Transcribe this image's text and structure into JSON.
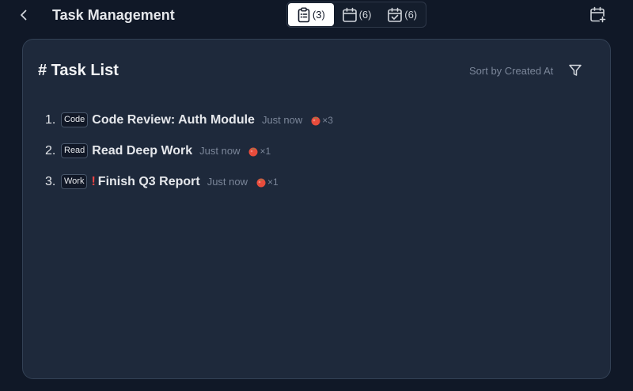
{
  "header": {
    "title": "Task Management",
    "tabs": [
      {
        "icon": "clipboard-list-icon",
        "count": "(3)",
        "active": true
      },
      {
        "icon": "calendar-icon",
        "count": "(6)",
        "active": false
      },
      {
        "icon": "calendar-check-icon",
        "count": "(6)",
        "active": false
      }
    ]
  },
  "panel": {
    "title": "# Task List",
    "sort_label": "Sort by Created At"
  },
  "tasks": [
    {
      "num": "1.",
      "tag": "Code",
      "urgent": "",
      "title": "Code Review: Auth Module",
      "time": "Just now",
      "pomodoros": "×3"
    },
    {
      "num": "2.",
      "tag": "Read",
      "urgent": "",
      "title": "Read Deep Work",
      "time": "Just now",
      "pomodoros": "×1"
    },
    {
      "num": "3.",
      "tag": "Work",
      "urgent": "!",
      "title": "Finish Q3 Report",
      "time": "Just now",
      "pomodoros": "×1"
    }
  ],
  "colors": {
    "background": "#101827",
    "panel": "#1e293b",
    "accent_tomato": "#e74c3c",
    "urgent": "#ef4444"
  }
}
